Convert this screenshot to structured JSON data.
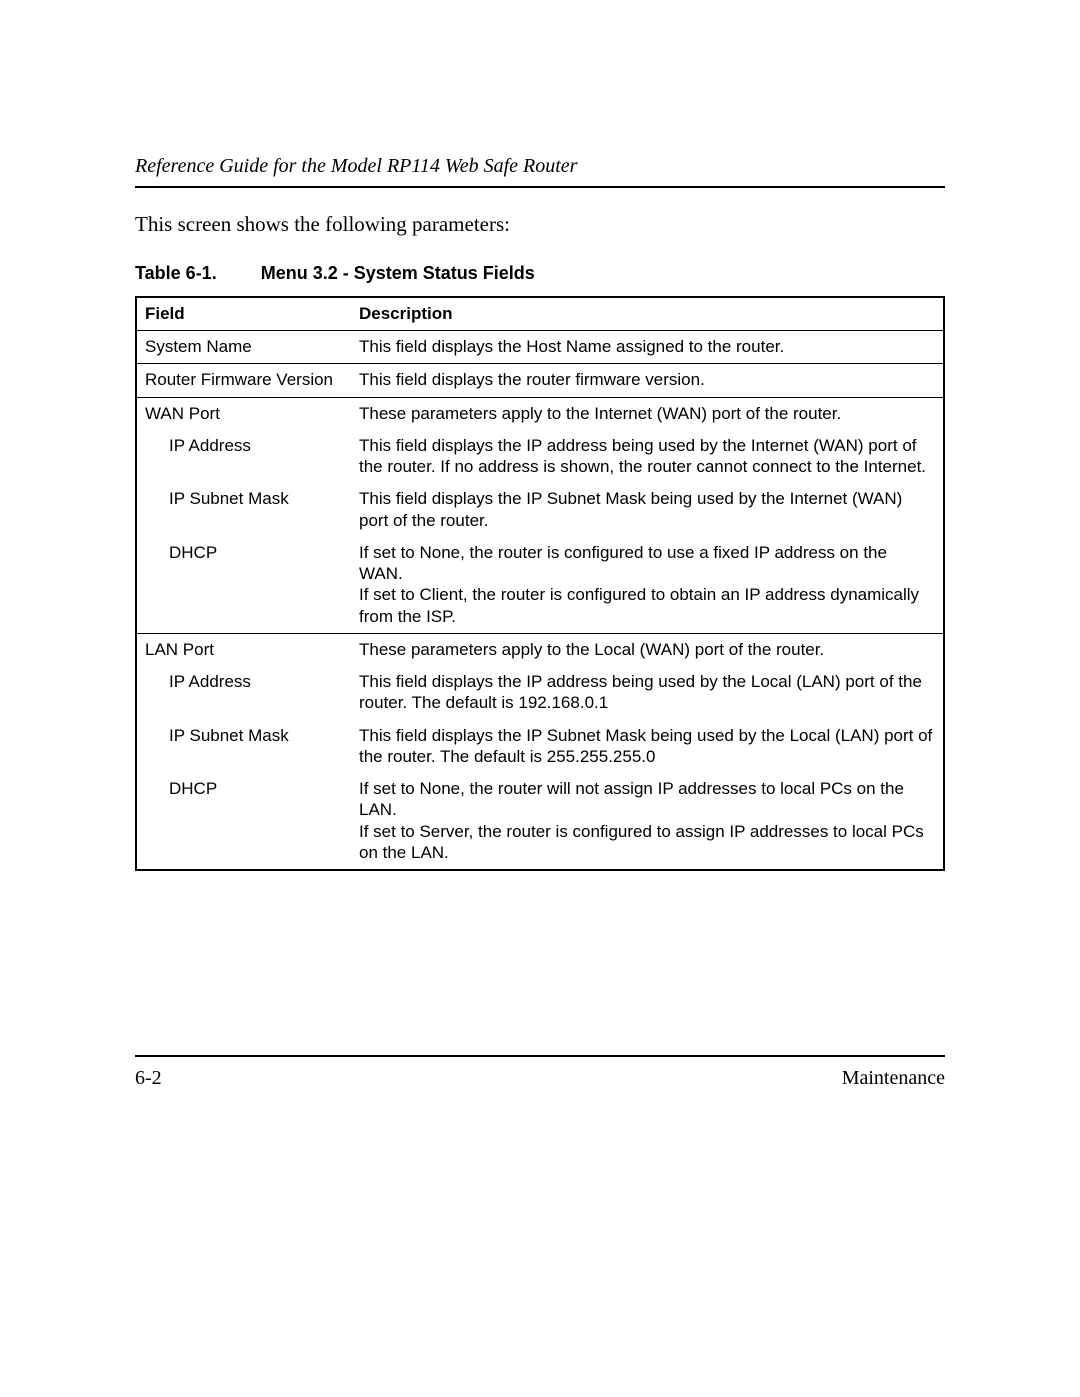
{
  "header": {
    "title": "Reference Guide for the Model RP114 Web Safe Router"
  },
  "intro": "This screen shows the following parameters:",
  "tableCaption": {
    "label": "Table 6-1.",
    "title": "Menu 3.2 - System Status Fields"
  },
  "columns": {
    "field": "Field",
    "description": "Description"
  },
  "rows": [
    {
      "field": "System Name",
      "indent": false,
      "sep": true,
      "description": "This field displays the Host Name assigned to the router."
    },
    {
      "field": "Router Firmware Version",
      "indent": false,
      "sep": true,
      "description": "This field displays the router firmware version."
    },
    {
      "field": "WAN Port",
      "indent": false,
      "sep": true,
      "description": "These parameters apply to the Internet (WAN) port of the router."
    },
    {
      "field": "IP Address",
      "indent": true,
      "sep": false,
      "description": "This field displays the IP address being used by the Internet (WAN) port of the router. If no address is shown, the router cannot connect to the Internet."
    },
    {
      "field": "IP Subnet Mask",
      "indent": true,
      "sep": false,
      "description": "This field displays the IP Subnet Mask being used by the Internet (WAN) port of the router."
    },
    {
      "field": "DHCP",
      "indent": true,
      "sep": false,
      "description": "If set to None, the router is configured to use a fixed IP address on the WAN.\nIf set to Client, the router is configured to obtain an IP address dynamically from the ISP."
    },
    {
      "field": "LAN Port",
      "indent": false,
      "sep": true,
      "description": "These parameters apply to the Local (WAN) port of the router."
    },
    {
      "field": "IP Address",
      "indent": true,
      "sep": false,
      "description": "This field displays the IP address being used by the Local (LAN) port of the router. The default is 192.168.0.1"
    },
    {
      "field": "IP Subnet Mask",
      "indent": true,
      "sep": false,
      "description": "This field displays the IP Subnet Mask being used by the Local (LAN) port of the router. The default is 255.255.255.0"
    },
    {
      "field": "DHCP",
      "indent": true,
      "sep": false,
      "description": "If set to None, the router will not assign IP addresses to local PCs on the LAN.\nIf set to Server, the router is configured to assign IP addresses to local PCs on the LAN."
    }
  ],
  "footer": {
    "pageNumber": "6-2",
    "section": "Maintenance"
  }
}
